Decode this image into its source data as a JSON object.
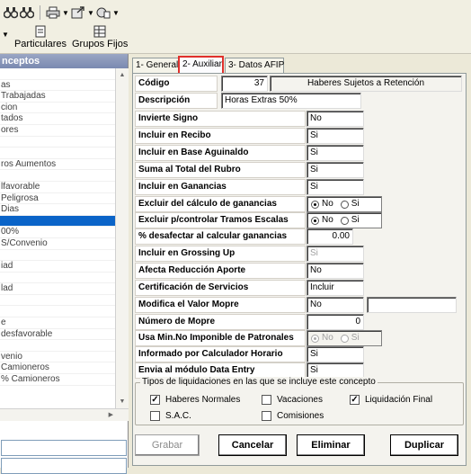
{
  "toolbar": {
    "row_icons": [
      "binoculars-icon",
      "binoculars-next-icon",
      "print-icon",
      "export-icon",
      "tools-icon"
    ],
    "buttons": [
      {
        "label": "Particulares",
        "icon": "document-icon"
      },
      {
        "label": "Grupos Fijos",
        "icon": "grid-icon"
      }
    ]
  },
  "left": {
    "header": "nceptos",
    "items": [
      "",
      "as",
      "Trabajadas",
      "cion",
      "tados",
      "ores",
      "",
      "",
      "ros Aumentos",
      "",
      "lfavorable",
      " Peligrosa",
      " Dias",
      "",
      "00%",
      "S/Convenio",
      "",
      "iad",
      "",
      "lad",
      "",
      "",
      "e",
      "desfavorable",
      "",
      "venio",
      " Camioneros",
      "% Camioneros"
    ],
    "selected_index": 13
  },
  "tabs": [
    "1- General",
    "2- Auxiliar",
    "3- Datos AFIP"
  ],
  "form": {
    "codigo_label": "Código",
    "codigo_value": "37",
    "codigo_desc": "Haberes Sujetos a Retención",
    "descripcion_label": "Descripción",
    "descripcion_value": "Horas Extras 50%",
    "rows": [
      {
        "label": "Invierte Signo",
        "value": "No"
      },
      {
        "label": "Incluir en Recibo",
        "value": "Si"
      },
      {
        "label": "Incluir en Base Aguinaldo",
        "value": "Si"
      },
      {
        "label": "Suma al Total del Rubro",
        "value": "Si"
      },
      {
        "label": "Incluir en Ganancias",
        "value": "Si"
      }
    ],
    "radio_rows": [
      {
        "label": "Excluir del cálculo de ganancias",
        "opt1": "No",
        "opt2": "Si"
      },
      {
        "label": "Excluir p/controlar Tramos Escalas",
        "opt1": "No",
        "opt2": "Si"
      }
    ],
    "desafectar_label": "% desafectar al calcular ganancias",
    "desafectar_value": "0.00",
    "rows2": [
      {
        "label": "Incluir en Grossing Up",
        "value": "Si"
      },
      {
        "label": "Afecta Reducción Aporte",
        "value": "No"
      },
      {
        "label": "Certificación de Servicios",
        "value": "Incluir"
      },
      {
        "label": "Modifica el Valor Mopre",
        "value": "No"
      }
    ],
    "mopre_label": "Número de Mopre",
    "mopre_value": "0",
    "min_no_imponible_label": "Usa Min.No Imponible de Patronales",
    "min_no_imponible_opt1": "No",
    "min_no_imponible_opt2": "Si",
    "rows3": [
      {
        "label": "Informado por Calculador Horario",
        "value": "Si"
      },
      {
        "label": "Envia al módulo Data Entry",
        "value": "Si"
      }
    ]
  },
  "liquidaciones": {
    "title": "Tipos de liquidaciones en las que se incluye este concepto",
    "options": [
      {
        "label": "Haberes Normales",
        "checked": true
      },
      {
        "label": "Vacaciones",
        "checked": false
      },
      {
        "label": "Liquidación Final",
        "checked": true
      },
      {
        "label": "S.A.C.",
        "checked": false
      },
      {
        "label": "Comisiones",
        "checked": false
      }
    ]
  },
  "buttons": {
    "grabar": "Grabar",
    "cancelar": "Cancelar",
    "eliminar": "Eliminar",
    "duplicar": "Duplicar"
  }
}
